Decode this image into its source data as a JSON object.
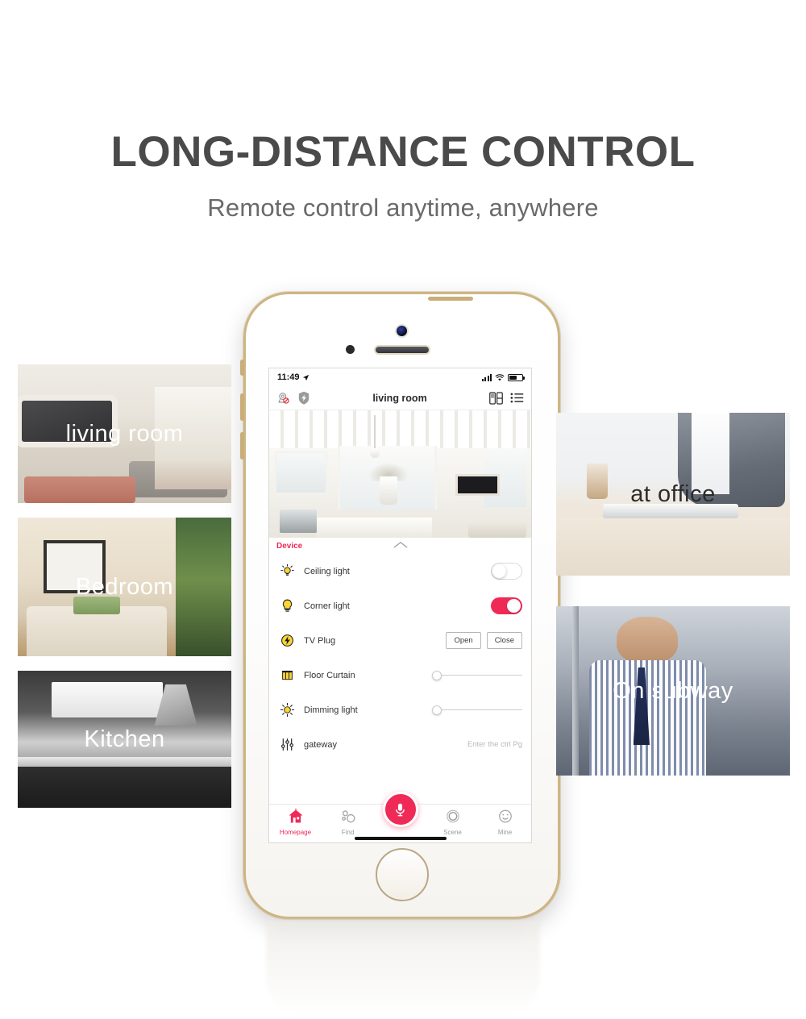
{
  "hero": {
    "headline": "LONG-DISTANCE CONTROL",
    "subhead": "Remote control anytime, anywhere"
  },
  "colors": {
    "accent": "#ef2a57",
    "headline": "#4a4a4a",
    "subhead": "#6a6a6a",
    "device_label": "#ef2a57",
    "phone_frame": "#cdb583"
  },
  "photos": {
    "left": [
      {
        "caption": "living room",
        "caption_color": "light",
        "art": "art-living"
      },
      {
        "caption": "Bedroom",
        "caption_color": "light",
        "art": "art-bedroom"
      },
      {
        "caption": "Kitchen",
        "caption_color": "light",
        "art": "art-kitchen"
      }
    ],
    "right": [
      {
        "caption": "at office",
        "caption_color": "dark",
        "art": "art-office"
      },
      {
        "caption": "On subway",
        "caption_color": "light",
        "art": "art-subway"
      }
    ]
  },
  "phone": {
    "statusbar": {
      "time": "11:49",
      "location_icon": "➤",
      "signal_icon": "signal-bars-icon",
      "wifi_icon": "wifi-icon",
      "battery_icon": "battery-icon",
      "battery_level": "62%"
    },
    "appbar": {
      "title": "living room",
      "left_icons": [
        "camera-disabled-icon",
        "shield-bolt-icon"
      ],
      "right_icons": [
        "panel-layout-icon",
        "list-menu-icon"
      ]
    },
    "panel": {
      "section_label": "Device",
      "collapse_icon": "chevron-up-icon"
    },
    "devices": [
      {
        "name": "Ceiling light",
        "icon": "ceiling-light-icon",
        "control": "toggle",
        "state": "off"
      },
      {
        "name": "Corner light",
        "icon": "bulb-icon",
        "control": "toggle",
        "state": "on"
      },
      {
        "name": "TV Plug",
        "icon": "power-plug-icon",
        "control": "buttons",
        "buttons": [
          "Open",
          "Close"
        ]
      },
      {
        "name": "Floor Curtain",
        "icon": "curtain-icon",
        "control": "slider",
        "value": 0
      },
      {
        "name": "Dimming light",
        "icon": "brightness-icon",
        "control": "slider",
        "value": 0
      },
      {
        "name": "gateway",
        "icon": "sliders-icon",
        "control": "hint",
        "hint": "Enter the ctrl Pg"
      }
    ],
    "tabbar": {
      "items": [
        {
          "label": "Homepage",
          "icon": "house-icon",
          "active": true
        },
        {
          "label": "Find",
          "icon": "find-icon",
          "active": false
        },
        {
          "label": "Scene",
          "icon": "scene-icon",
          "active": false
        },
        {
          "label": "Mine",
          "icon": "smiley-icon",
          "active": false
        }
      ],
      "fab": {
        "icon": "microphone-icon",
        "label": "Voice"
      }
    }
  }
}
